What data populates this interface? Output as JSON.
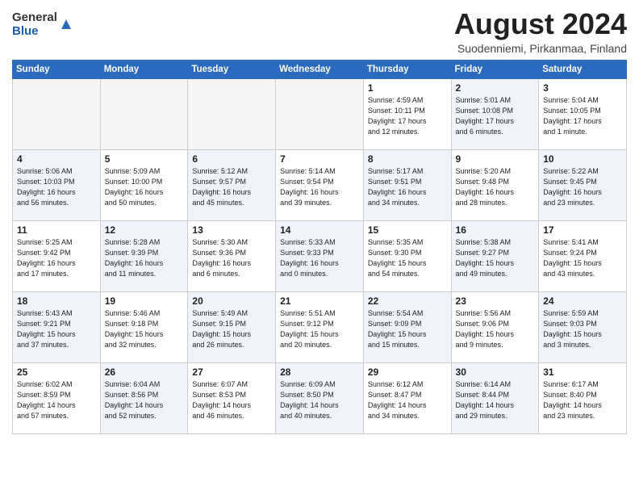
{
  "header": {
    "logo_general": "General",
    "logo_blue": "Blue",
    "title": "August 2024",
    "subtitle": "Suodenniemi, Pirkanmaa, Finland"
  },
  "weekdays": [
    "Sunday",
    "Monday",
    "Tuesday",
    "Wednesday",
    "Thursday",
    "Friday",
    "Saturday"
  ],
  "weeks": [
    [
      {
        "day": "",
        "info": "",
        "shaded": false,
        "empty": true
      },
      {
        "day": "",
        "info": "",
        "shaded": false,
        "empty": true
      },
      {
        "day": "",
        "info": "",
        "shaded": false,
        "empty": true
      },
      {
        "day": "",
        "info": "",
        "shaded": false,
        "empty": true
      },
      {
        "day": "1",
        "info": "Sunrise: 4:59 AM\nSunset: 10:11 PM\nDaylight: 17 hours\nand 12 minutes.",
        "shaded": false,
        "empty": false
      },
      {
        "day": "2",
        "info": "Sunrise: 5:01 AM\nSunset: 10:08 PM\nDaylight: 17 hours\nand 6 minutes.",
        "shaded": true,
        "empty": false
      },
      {
        "day": "3",
        "info": "Sunrise: 5:04 AM\nSunset: 10:05 PM\nDaylight: 17 hours\nand 1 minute.",
        "shaded": false,
        "empty": false
      }
    ],
    [
      {
        "day": "4",
        "info": "Sunrise: 5:06 AM\nSunset: 10:03 PM\nDaylight: 16 hours\nand 56 minutes.",
        "shaded": true,
        "empty": false
      },
      {
        "day": "5",
        "info": "Sunrise: 5:09 AM\nSunset: 10:00 PM\nDaylight: 16 hours\nand 50 minutes.",
        "shaded": false,
        "empty": false
      },
      {
        "day": "6",
        "info": "Sunrise: 5:12 AM\nSunset: 9:57 PM\nDaylight: 16 hours\nand 45 minutes.",
        "shaded": true,
        "empty": false
      },
      {
        "day": "7",
        "info": "Sunrise: 5:14 AM\nSunset: 9:54 PM\nDaylight: 16 hours\nand 39 minutes.",
        "shaded": false,
        "empty": false
      },
      {
        "day": "8",
        "info": "Sunrise: 5:17 AM\nSunset: 9:51 PM\nDaylight: 16 hours\nand 34 minutes.",
        "shaded": true,
        "empty": false
      },
      {
        "day": "9",
        "info": "Sunrise: 5:20 AM\nSunset: 9:48 PM\nDaylight: 16 hours\nand 28 minutes.",
        "shaded": false,
        "empty": false
      },
      {
        "day": "10",
        "info": "Sunrise: 5:22 AM\nSunset: 9:45 PM\nDaylight: 16 hours\nand 23 minutes.",
        "shaded": true,
        "empty": false
      }
    ],
    [
      {
        "day": "11",
        "info": "Sunrise: 5:25 AM\nSunset: 9:42 PM\nDaylight: 16 hours\nand 17 minutes.",
        "shaded": false,
        "empty": false
      },
      {
        "day": "12",
        "info": "Sunrise: 5:28 AM\nSunset: 9:39 PM\nDaylight: 16 hours\nand 11 minutes.",
        "shaded": true,
        "empty": false
      },
      {
        "day": "13",
        "info": "Sunrise: 5:30 AM\nSunset: 9:36 PM\nDaylight: 16 hours\nand 6 minutes.",
        "shaded": false,
        "empty": false
      },
      {
        "day": "14",
        "info": "Sunrise: 5:33 AM\nSunset: 9:33 PM\nDaylight: 16 hours\nand 0 minutes.",
        "shaded": true,
        "empty": false
      },
      {
        "day": "15",
        "info": "Sunrise: 5:35 AM\nSunset: 9:30 PM\nDaylight: 15 hours\nand 54 minutes.",
        "shaded": false,
        "empty": false
      },
      {
        "day": "16",
        "info": "Sunrise: 5:38 AM\nSunset: 9:27 PM\nDaylight: 15 hours\nand 49 minutes.",
        "shaded": true,
        "empty": false
      },
      {
        "day": "17",
        "info": "Sunrise: 5:41 AM\nSunset: 9:24 PM\nDaylight: 15 hours\nand 43 minutes.",
        "shaded": false,
        "empty": false
      }
    ],
    [
      {
        "day": "18",
        "info": "Sunrise: 5:43 AM\nSunset: 9:21 PM\nDaylight: 15 hours\nand 37 minutes.",
        "shaded": true,
        "empty": false
      },
      {
        "day": "19",
        "info": "Sunrise: 5:46 AM\nSunset: 9:18 PM\nDaylight: 15 hours\nand 32 minutes.",
        "shaded": false,
        "empty": false
      },
      {
        "day": "20",
        "info": "Sunrise: 5:49 AM\nSunset: 9:15 PM\nDaylight: 15 hours\nand 26 minutes.",
        "shaded": true,
        "empty": false
      },
      {
        "day": "21",
        "info": "Sunrise: 5:51 AM\nSunset: 9:12 PM\nDaylight: 15 hours\nand 20 minutes.",
        "shaded": false,
        "empty": false
      },
      {
        "day": "22",
        "info": "Sunrise: 5:54 AM\nSunset: 9:09 PM\nDaylight: 15 hours\nand 15 minutes.",
        "shaded": true,
        "empty": false
      },
      {
        "day": "23",
        "info": "Sunrise: 5:56 AM\nSunset: 9:06 PM\nDaylight: 15 hours\nand 9 minutes.",
        "shaded": false,
        "empty": false
      },
      {
        "day": "24",
        "info": "Sunrise: 5:59 AM\nSunset: 9:03 PM\nDaylight: 15 hours\nand 3 minutes.",
        "shaded": true,
        "empty": false
      }
    ],
    [
      {
        "day": "25",
        "info": "Sunrise: 6:02 AM\nSunset: 8:59 PM\nDaylight: 14 hours\nand 57 minutes.",
        "shaded": false,
        "empty": false
      },
      {
        "day": "26",
        "info": "Sunrise: 6:04 AM\nSunset: 8:56 PM\nDaylight: 14 hours\nand 52 minutes.",
        "shaded": true,
        "empty": false
      },
      {
        "day": "27",
        "info": "Sunrise: 6:07 AM\nSunset: 8:53 PM\nDaylight: 14 hours\nand 46 minutes.",
        "shaded": false,
        "empty": false
      },
      {
        "day": "28",
        "info": "Sunrise: 6:09 AM\nSunset: 8:50 PM\nDaylight: 14 hours\nand 40 minutes.",
        "shaded": true,
        "empty": false
      },
      {
        "day": "29",
        "info": "Sunrise: 6:12 AM\nSunset: 8:47 PM\nDaylight: 14 hours\nand 34 minutes.",
        "shaded": false,
        "empty": false
      },
      {
        "day": "30",
        "info": "Sunrise: 6:14 AM\nSunset: 8:44 PM\nDaylight: 14 hours\nand 29 minutes.",
        "shaded": true,
        "empty": false
      },
      {
        "day": "31",
        "info": "Sunrise: 6:17 AM\nSunset: 8:40 PM\nDaylight: 14 hours\nand 23 minutes.",
        "shaded": false,
        "empty": false
      }
    ]
  ]
}
